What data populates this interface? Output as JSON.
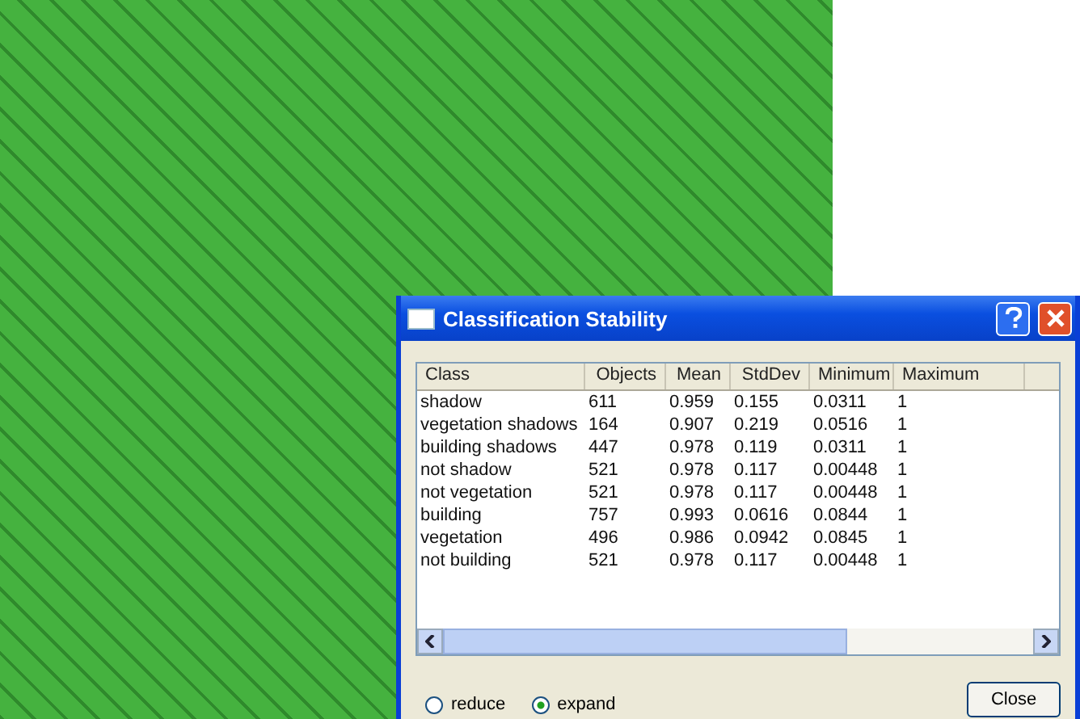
{
  "window": {
    "title": "Classification Stability"
  },
  "table": {
    "columns": [
      "Class",
      "Objects",
      "Mean",
      "StdDev",
      "Minimum",
      "Maximum"
    ],
    "rows": [
      [
        "shadow",
        "611",
        "0.959",
        "0.155",
        "0.0311",
        "1"
      ],
      [
        "vegetation shadows",
        "164",
        "0.907",
        "0.219",
        "0.0516",
        "1"
      ],
      [
        "building shadows",
        "447",
        "0.978",
        "0.119",
        "0.0311",
        "1"
      ],
      [
        "not shadow",
        "521",
        "0.978",
        "0.117",
        "0.00448",
        "1"
      ],
      [
        "not vegetation",
        "521",
        "0.978",
        "0.117",
        "0.00448",
        "1"
      ],
      [
        "building",
        "757",
        "0.993",
        "0.0616",
        "0.0844",
        "1"
      ],
      [
        "vegetation",
        "496",
        "0.986",
        "0.0942",
        "0.0845",
        "1"
      ],
      [
        "not building",
        "521",
        "0.978",
        "0.117",
        "0.00448",
        "1"
      ]
    ]
  },
  "options": [
    {
      "label": "reduce",
      "selected": false
    },
    {
      "label": "expand",
      "selected": true
    }
  ],
  "buttons": [
    "Close"
  ]
}
